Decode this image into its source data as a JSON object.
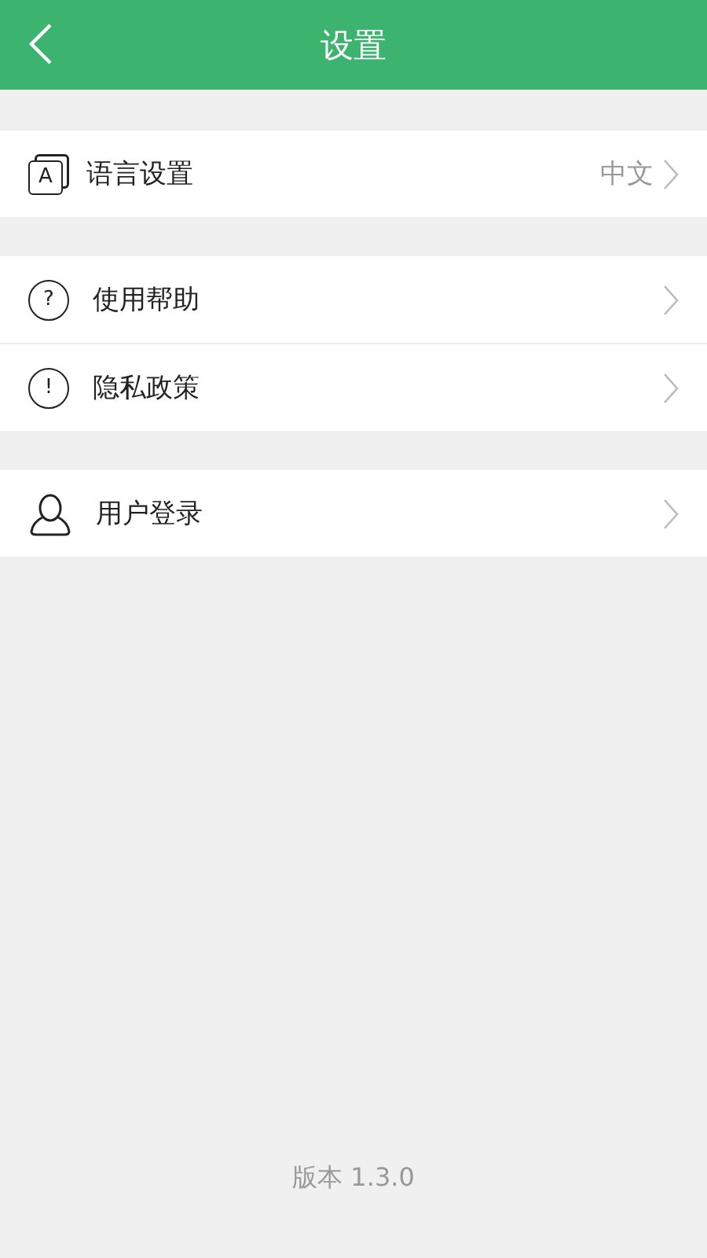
{
  "header": {
    "title": "设置"
  },
  "groups": [
    {
      "items": [
        {
          "kind": "language",
          "icon_char": "A",
          "label": "语言设置",
          "value": "中文"
        }
      ]
    },
    {
      "items": [
        {
          "kind": "circle",
          "icon_char": "?",
          "label": "使用帮助"
        },
        {
          "kind": "circle",
          "icon_char": "!",
          "label": "隐私政策"
        }
      ]
    },
    {
      "items": [
        {
          "kind": "user",
          "label": "用户登录"
        }
      ]
    }
  ],
  "version": "版本 1.3.0"
}
